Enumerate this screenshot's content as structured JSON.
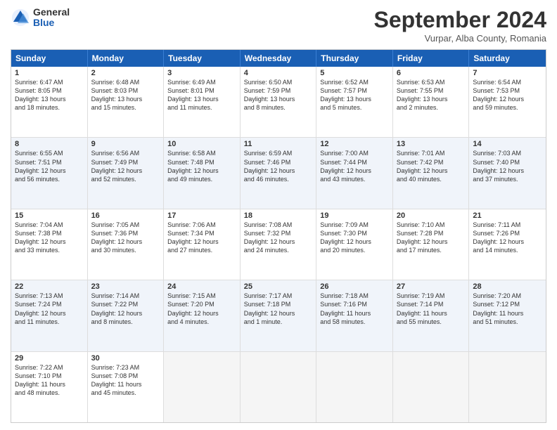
{
  "header": {
    "logo_general": "General",
    "logo_blue": "Blue",
    "month_title": "September 2024",
    "location": "Vurpar, Alba County, Romania"
  },
  "days_of_week": [
    "Sunday",
    "Monday",
    "Tuesday",
    "Wednesday",
    "Thursday",
    "Friday",
    "Saturday"
  ],
  "rows": [
    [
      {
        "day": "1",
        "lines": [
          "Sunrise: 6:47 AM",
          "Sunset: 8:05 PM",
          "Daylight: 13 hours",
          "and 18 minutes."
        ],
        "shaded": false
      },
      {
        "day": "2",
        "lines": [
          "Sunrise: 6:48 AM",
          "Sunset: 8:03 PM",
          "Daylight: 13 hours",
          "and 15 minutes."
        ],
        "shaded": false
      },
      {
        "day": "3",
        "lines": [
          "Sunrise: 6:49 AM",
          "Sunset: 8:01 PM",
          "Daylight: 13 hours",
          "and 11 minutes."
        ],
        "shaded": false
      },
      {
        "day": "4",
        "lines": [
          "Sunrise: 6:50 AM",
          "Sunset: 7:59 PM",
          "Daylight: 13 hours",
          "and 8 minutes."
        ],
        "shaded": false
      },
      {
        "day": "5",
        "lines": [
          "Sunrise: 6:52 AM",
          "Sunset: 7:57 PM",
          "Daylight: 13 hours",
          "and 5 minutes."
        ],
        "shaded": false
      },
      {
        "day": "6",
        "lines": [
          "Sunrise: 6:53 AM",
          "Sunset: 7:55 PM",
          "Daylight: 13 hours",
          "and 2 minutes."
        ],
        "shaded": false
      },
      {
        "day": "7",
        "lines": [
          "Sunrise: 6:54 AM",
          "Sunset: 7:53 PM",
          "Daylight: 12 hours",
          "and 59 minutes."
        ],
        "shaded": false
      }
    ],
    [
      {
        "day": "8",
        "lines": [
          "Sunrise: 6:55 AM",
          "Sunset: 7:51 PM",
          "Daylight: 12 hours",
          "and 56 minutes."
        ],
        "shaded": true
      },
      {
        "day": "9",
        "lines": [
          "Sunrise: 6:56 AM",
          "Sunset: 7:49 PM",
          "Daylight: 12 hours",
          "and 52 minutes."
        ],
        "shaded": true
      },
      {
        "day": "10",
        "lines": [
          "Sunrise: 6:58 AM",
          "Sunset: 7:48 PM",
          "Daylight: 12 hours",
          "and 49 minutes."
        ],
        "shaded": true
      },
      {
        "day": "11",
        "lines": [
          "Sunrise: 6:59 AM",
          "Sunset: 7:46 PM",
          "Daylight: 12 hours",
          "and 46 minutes."
        ],
        "shaded": true
      },
      {
        "day": "12",
        "lines": [
          "Sunrise: 7:00 AM",
          "Sunset: 7:44 PM",
          "Daylight: 12 hours",
          "and 43 minutes."
        ],
        "shaded": true
      },
      {
        "day": "13",
        "lines": [
          "Sunrise: 7:01 AM",
          "Sunset: 7:42 PM",
          "Daylight: 12 hours",
          "and 40 minutes."
        ],
        "shaded": true
      },
      {
        "day": "14",
        "lines": [
          "Sunrise: 7:03 AM",
          "Sunset: 7:40 PM",
          "Daylight: 12 hours",
          "and 37 minutes."
        ],
        "shaded": true
      }
    ],
    [
      {
        "day": "15",
        "lines": [
          "Sunrise: 7:04 AM",
          "Sunset: 7:38 PM",
          "Daylight: 12 hours",
          "and 33 minutes."
        ],
        "shaded": false
      },
      {
        "day": "16",
        "lines": [
          "Sunrise: 7:05 AM",
          "Sunset: 7:36 PM",
          "Daylight: 12 hours",
          "and 30 minutes."
        ],
        "shaded": false
      },
      {
        "day": "17",
        "lines": [
          "Sunrise: 7:06 AM",
          "Sunset: 7:34 PM",
          "Daylight: 12 hours",
          "and 27 minutes."
        ],
        "shaded": false
      },
      {
        "day": "18",
        "lines": [
          "Sunrise: 7:08 AM",
          "Sunset: 7:32 PM",
          "Daylight: 12 hours",
          "and 24 minutes."
        ],
        "shaded": false
      },
      {
        "day": "19",
        "lines": [
          "Sunrise: 7:09 AM",
          "Sunset: 7:30 PM",
          "Daylight: 12 hours",
          "and 20 minutes."
        ],
        "shaded": false
      },
      {
        "day": "20",
        "lines": [
          "Sunrise: 7:10 AM",
          "Sunset: 7:28 PM",
          "Daylight: 12 hours",
          "and 17 minutes."
        ],
        "shaded": false
      },
      {
        "day": "21",
        "lines": [
          "Sunrise: 7:11 AM",
          "Sunset: 7:26 PM",
          "Daylight: 12 hours",
          "and 14 minutes."
        ],
        "shaded": false
      }
    ],
    [
      {
        "day": "22",
        "lines": [
          "Sunrise: 7:13 AM",
          "Sunset: 7:24 PM",
          "Daylight: 12 hours",
          "and 11 minutes."
        ],
        "shaded": true
      },
      {
        "day": "23",
        "lines": [
          "Sunrise: 7:14 AM",
          "Sunset: 7:22 PM",
          "Daylight: 12 hours",
          "and 8 minutes."
        ],
        "shaded": true
      },
      {
        "day": "24",
        "lines": [
          "Sunrise: 7:15 AM",
          "Sunset: 7:20 PM",
          "Daylight: 12 hours",
          "and 4 minutes."
        ],
        "shaded": true
      },
      {
        "day": "25",
        "lines": [
          "Sunrise: 7:17 AM",
          "Sunset: 7:18 PM",
          "Daylight: 12 hours",
          "and 1 minute."
        ],
        "shaded": true
      },
      {
        "day": "26",
        "lines": [
          "Sunrise: 7:18 AM",
          "Sunset: 7:16 PM",
          "Daylight: 11 hours",
          "and 58 minutes."
        ],
        "shaded": true
      },
      {
        "day": "27",
        "lines": [
          "Sunrise: 7:19 AM",
          "Sunset: 7:14 PM",
          "Daylight: 11 hours",
          "and 55 minutes."
        ],
        "shaded": true
      },
      {
        "day": "28",
        "lines": [
          "Sunrise: 7:20 AM",
          "Sunset: 7:12 PM",
          "Daylight: 11 hours",
          "and 51 minutes."
        ],
        "shaded": true
      }
    ],
    [
      {
        "day": "29",
        "lines": [
          "Sunrise: 7:22 AM",
          "Sunset: 7:10 PM",
          "Daylight: 11 hours",
          "and 48 minutes."
        ],
        "shaded": false
      },
      {
        "day": "30",
        "lines": [
          "Sunrise: 7:23 AM",
          "Sunset: 7:08 PM",
          "Daylight: 11 hours",
          "and 45 minutes."
        ],
        "shaded": false
      },
      {
        "day": "",
        "lines": [],
        "shaded": false,
        "empty": true
      },
      {
        "day": "",
        "lines": [],
        "shaded": false,
        "empty": true
      },
      {
        "day": "",
        "lines": [],
        "shaded": false,
        "empty": true
      },
      {
        "day": "",
        "lines": [],
        "shaded": false,
        "empty": true
      },
      {
        "day": "",
        "lines": [],
        "shaded": false,
        "empty": true
      }
    ]
  ]
}
